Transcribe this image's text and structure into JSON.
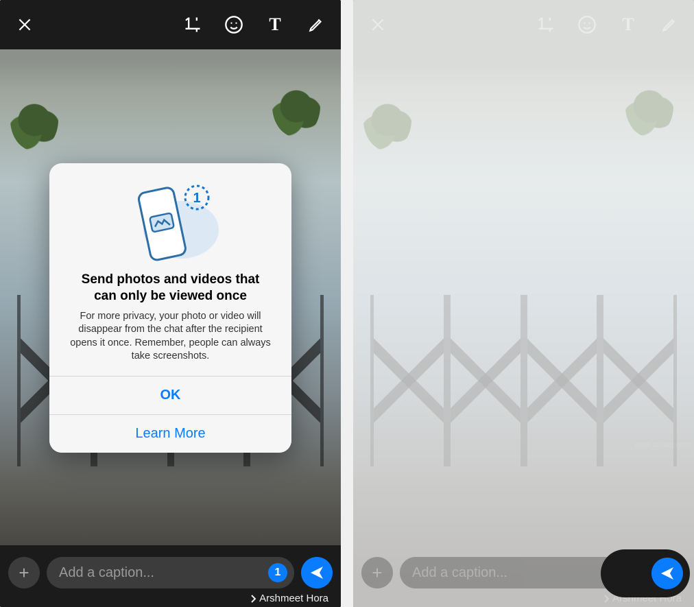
{
  "toolbar": {
    "close_icon": "close",
    "crop_icon": "crop-rotate",
    "emoji_icon": "emoji",
    "text_icon": "T",
    "draw_icon": "pencil"
  },
  "dialog": {
    "title": "Send photos and videos that can only be viewed once",
    "body": "For more privacy, your photo or video will disappear from the chat after the recipient opens it once. Remember, people can always take screenshots.",
    "ok_label": "OK",
    "learn_label": "Learn More",
    "illus_badge": "1"
  },
  "bottom": {
    "add_label": "+",
    "caption_placeholder": "Add a caption...",
    "view_once_label": "1",
    "recipient_name": "Arshmeet Hora"
  },
  "watermark": "www.deuaq.com"
}
